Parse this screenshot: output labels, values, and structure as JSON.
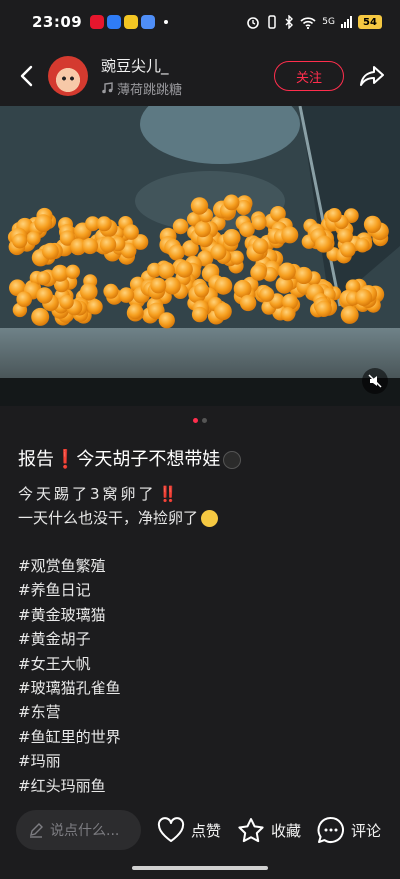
{
  "status_bar": {
    "time": "23:09",
    "battery": "54",
    "network": "5G"
  },
  "header": {
    "username": "豌豆尖儿_",
    "music_name": "薄荷跳跳糖",
    "follow_label": "关注"
  },
  "carousel": {
    "total": 2,
    "active_index": 1
  },
  "post": {
    "title": "报告❗今天胡子不想带娃",
    "line1_prefix": "今天踢了3窝卵了",
    "line1_suffix": "‼️",
    "line2": "一天什么也没干，净捡卵了",
    "tags": [
      "#观赏鱼繁殖",
      "#养鱼日记",
      "#黄金玻璃猫",
      "#黄金胡子",
      "#女王大帆",
      "#玻璃猫孔雀鱼",
      "#东营",
      "#鱼缸里的世界",
      "#玛丽",
      "#红头玛丽鱼"
    ]
  },
  "bottom_bar": {
    "comment_placeholder": "说点什么...",
    "like_label": "点赞",
    "collect_label": "收藏",
    "comment_label": "评论"
  },
  "colors": {
    "accent": "#ff2e4d",
    "background": "#1c1c1e",
    "egg": "#f7a020"
  }
}
